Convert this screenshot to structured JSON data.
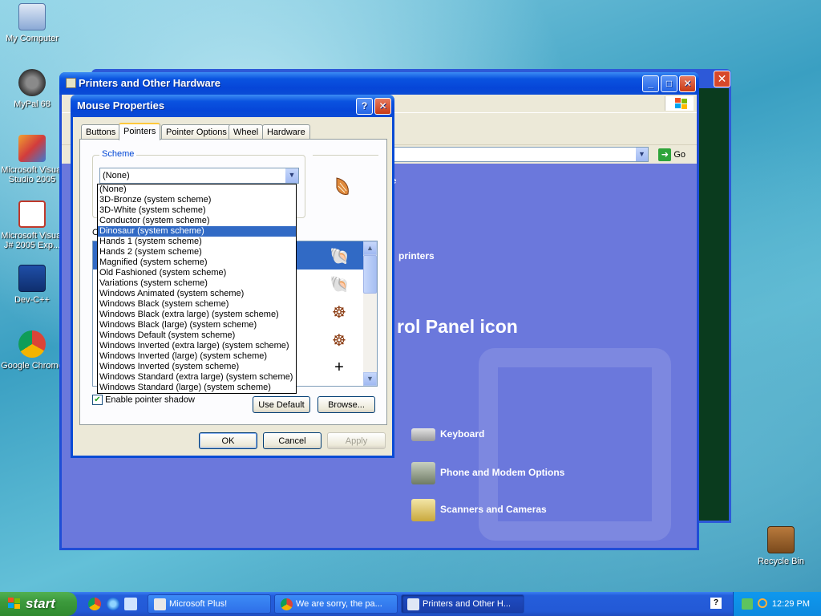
{
  "desktop": {
    "icons": [
      {
        "label": "My Computer"
      },
      {
        "label": "MyPal 68"
      },
      {
        "label": "Microsoft Visual Studio 2005"
      },
      {
        "label": "Microsoft Visual J# 2005 Exp..."
      },
      {
        "label": "Dev-C++"
      },
      {
        "label": "Google Chrome"
      },
      {
        "label": "Recycle Bin"
      }
    ]
  },
  "explorer": {
    "title": "Printers and Other Hardware",
    "go_label": "Go",
    "header_fragment": "re",
    "task_fragment": "printers",
    "pick_title_fragment": "rol Panel icon",
    "items": [
      {
        "label": "Keyboard"
      },
      {
        "label": "Phone and Modem Options"
      },
      {
        "label": "Scanners and Cameras"
      }
    ]
  },
  "dialog": {
    "title": "Mouse Properties",
    "help": "?",
    "tabs": [
      "Buttons",
      "Pointers",
      "Pointer Options",
      "Wheel",
      "Hardware"
    ],
    "active_tab": "Pointers",
    "scheme_label": "Scheme",
    "scheme_value": "(None)",
    "customize_label_fragment": "C",
    "scheme_options": [
      "(None)",
      "3D-Bronze (system scheme)",
      "3D-White (system scheme)",
      "Conductor (system scheme)",
      "Dinosaur (system scheme)",
      "Hands 1 (system scheme)",
      "Hands 2 (system scheme)",
      "Magnified (system scheme)",
      "Old Fashioned (system scheme)",
      "Variations (system scheme)",
      "Windows Animated (system scheme)",
      "Windows Black  (system scheme)",
      "Windows Black (extra large) (system scheme)",
      "Windows Black (large) (system scheme)",
      "Windows Default (system scheme)",
      "Windows Inverted (extra large) (system scheme)",
      "Windows Inverted (large) (system scheme)",
      "Windows Inverted (system scheme)",
      "Windows Standard (extra large) (system scheme)",
      "Windows Standard (large) (system scheme)"
    ],
    "highlighted_option": "Dinosaur (system scheme)",
    "enable_shadow_label": "Enable pointer shadow",
    "use_default_label": "Use Default",
    "browse_label": "Browse...",
    "ok_label": "OK",
    "cancel_label": "Cancel",
    "apply_label": "Apply"
  },
  "taskbar": {
    "start_label": "start",
    "tasks": [
      {
        "label": "Microsoft Plus!"
      },
      {
        "label": "We are sorry, the pa..."
      },
      {
        "label": "Printers and Other H..."
      }
    ],
    "help_glyph": "?",
    "clock": "12:29 PM"
  }
}
